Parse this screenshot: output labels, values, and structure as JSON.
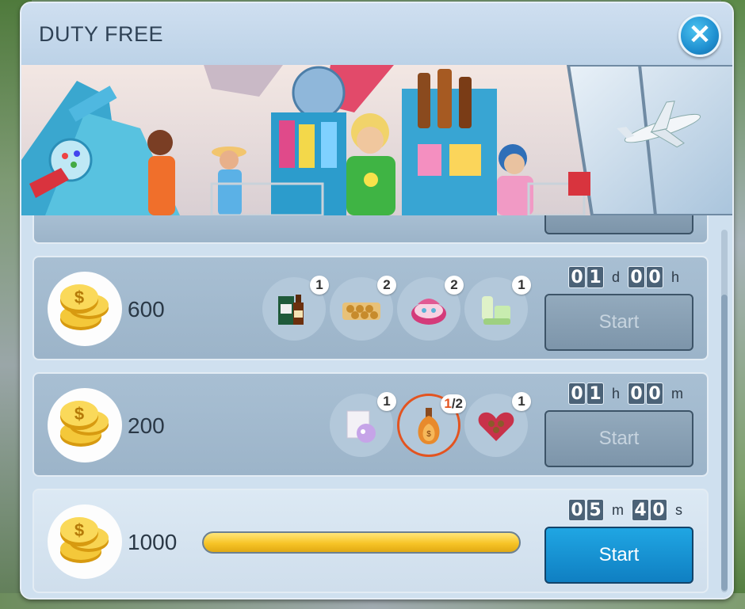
{
  "dialog": {
    "title": "DUTY FREE"
  },
  "icons": {
    "close": "close-icon",
    "coin": "coins-icon"
  },
  "colors": {
    "accent_blue": "#1a8fd0",
    "button_disabled": "#8aa1b5",
    "progress_fill": "#f7c427",
    "ring_highlight": "#e35420"
  },
  "orders": [
    {
      "reward": "600",
      "items": [
        {
          "name": "whiskey-icon",
          "count": "1"
        },
        {
          "name": "chocolate-box-icon",
          "count": "2"
        },
        {
          "name": "jewelry-box-icon",
          "count": "2"
        },
        {
          "name": "cosmetics-icon",
          "count": "1"
        }
      ],
      "timer": {
        "first": "01",
        "first_unit": "d",
        "second": "00",
        "second_unit": "h"
      },
      "button": "Start",
      "enabled": false
    },
    {
      "reward": "200",
      "items": [
        {
          "name": "perfume-box-icon",
          "count": "1"
        },
        {
          "name": "cognac-bottle-icon",
          "have": "1",
          "need": "/2"
        },
        {
          "name": "heart-candy-box-icon",
          "count": "1"
        }
      ],
      "timer": {
        "first": "01",
        "first_unit": "h",
        "second": "00",
        "second_unit": "m"
      },
      "button": "Start",
      "enabled": false
    },
    {
      "reward": "1000",
      "progress": 1.0,
      "timer": {
        "first": "05",
        "first_unit": "m",
        "second": "40",
        "second_unit": "s"
      },
      "button": "Start",
      "enabled": true
    }
  ]
}
